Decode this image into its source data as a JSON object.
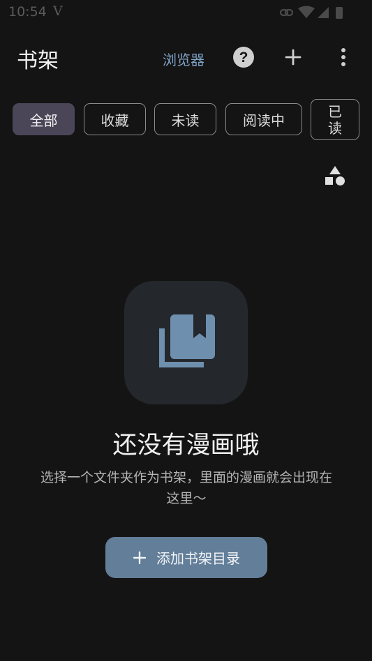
{
  "status_bar": {
    "time": "10:54",
    "indicator": "V",
    "icons": [
      "link-icon",
      "wifi-icon",
      "signal-icon",
      "battery-icon"
    ]
  },
  "app_bar": {
    "title": "书架",
    "browser_label": "浏览器",
    "icons": [
      "help-icon",
      "add-icon",
      "more-vert-icon"
    ]
  },
  "filters": {
    "chips": [
      "全部",
      "收藏",
      "未读",
      "阅读中",
      "已读"
    ],
    "selected": "全部"
  },
  "toolbar": {
    "icons": [
      "shapes-icon"
    ]
  },
  "empty_state": {
    "icon": "library-books-icon",
    "title": "还没有漫画哦",
    "description": "选择一个文件夹作为书架，里面的漫画就会出现在这里～",
    "button_label": "添加书架目录"
  },
  "colors": {
    "background": "#141414",
    "accent_link": "#7fa3c7",
    "selected_chip": "#4a4658",
    "primary_button": "#627e99",
    "tile": "#24272c"
  }
}
